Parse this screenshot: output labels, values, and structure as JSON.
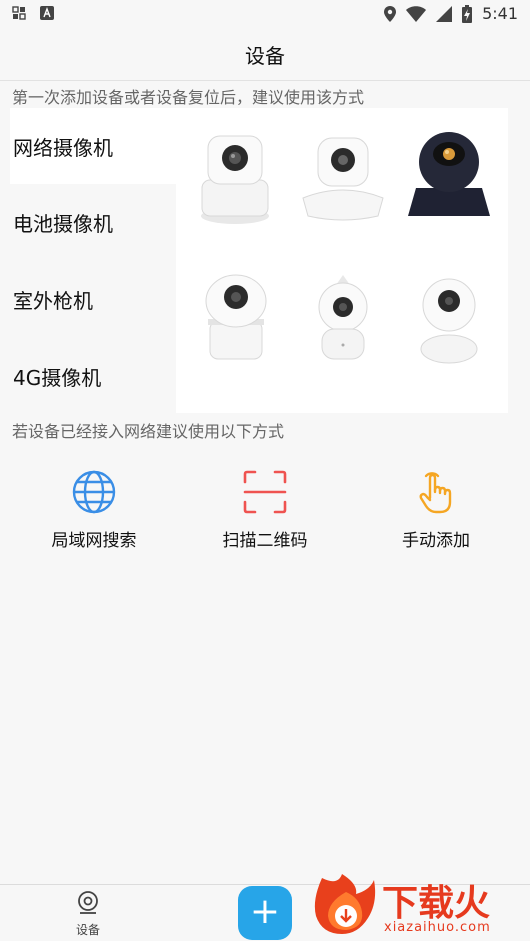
{
  "status_bar": {
    "time": "5:41",
    "left_icons": [
      "notification-grid-icon",
      "font-a-icon"
    ],
    "right_icons": [
      "location-icon",
      "wifi-icon",
      "signal-icon",
      "battery-charging-icon"
    ]
  },
  "header": {
    "title": "设备"
  },
  "hint_top": "第一次添加设备或者设备复位后，建议使用该方式",
  "categories": [
    {
      "label": "网络摄像机",
      "active": true
    },
    {
      "label": "电池摄像机",
      "active": false
    },
    {
      "label": "室外枪机",
      "active": false
    },
    {
      "label": "4G摄像机",
      "active": false
    }
  ],
  "cameras": [
    {
      "icon": "white-ptz-camera-icon"
    },
    {
      "icon": "dome-ptz-camera-icon"
    },
    {
      "icon": "black-ptz-camera-icon"
    },
    {
      "icon": "cube-camera-icon"
    },
    {
      "icon": "cone-top-camera-icon"
    },
    {
      "icon": "round-head-camera-icon"
    }
  ],
  "hint_bottom": "若设备已经接入网络建议使用以下方式",
  "methods": [
    {
      "label": "局域网搜索",
      "icon": "globe-icon",
      "color": "#3a8ee6"
    },
    {
      "label": "扫描二维码",
      "icon": "scan-frame-icon",
      "color": "#ef5350"
    },
    {
      "label": "手动添加",
      "icon": "hand-tap-icon",
      "color": "#f5a623"
    }
  ],
  "tab_bar": {
    "device_label": "设备",
    "add_icon": "plus-icon",
    "accent": "#27a5e8"
  },
  "watermark": {
    "text": "下载火",
    "url": "xiazaihuo.com"
  }
}
